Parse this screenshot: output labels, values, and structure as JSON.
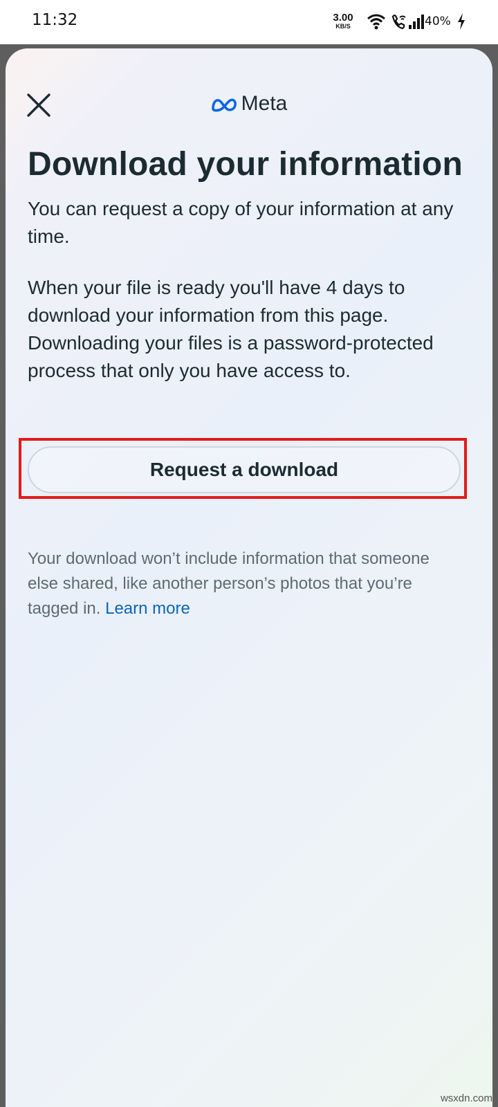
{
  "status_bar": {
    "time": "11:32",
    "net_speed_value": "3.00",
    "net_speed_unit": "KB/S",
    "battery": "40%",
    "icons": [
      "wifi-icon",
      "wifi-calling-icon",
      "signal-icon",
      "charging-icon"
    ]
  },
  "header": {
    "brand": "Meta",
    "close_icon": "close-icon",
    "logo_icon": "meta-infinity-logo-icon"
  },
  "main": {
    "title": "Download your information",
    "paragraph_1": "You can request a copy of your information at any time.",
    "paragraph_2": "When your file is ready you'll have 4 days to download your information from this page. Downloading your files is a password-protected process that only you have access to.",
    "request_button_label": "Request a download",
    "note_text": "Your download won’t include information that someone else shared, like another person’s photos that you’re tagged in. ",
    "learn_more_label": "Learn more"
  },
  "watermark": "wsxdn.com",
  "colors": {
    "accent_link": "#0a65b8",
    "highlight_border": "#e31a1a",
    "meta_blue": "#0668e1",
    "text_primary": "#1c2b33"
  }
}
